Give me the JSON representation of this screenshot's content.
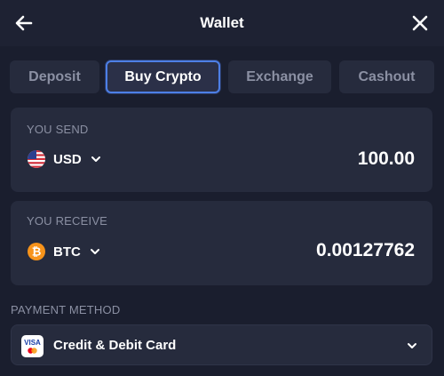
{
  "header": {
    "title": "Wallet",
    "back_icon": "arrow-left-icon",
    "close_icon": "close-icon"
  },
  "tabs": [
    {
      "label": "Deposit",
      "active": false
    },
    {
      "label": "Buy Crypto",
      "active": true
    },
    {
      "label": "Exchange",
      "active": false
    },
    {
      "label": "Cashout",
      "active": false
    }
  ],
  "send": {
    "label": "YOU SEND",
    "currency": "USD",
    "amount": "100.00",
    "icon": "us-flag-icon"
  },
  "receive": {
    "label": "YOU RECEIVE",
    "currency": "BTC",
    "amount": "0.00127762",
    "icon": "bitcoin-icon"
  },
  "payment": {
    "label": "PAYMENT METHOD",
    "selected": "Credit & Debit Card",
    "icon": "visa-mastercard-icon",
    "badge": "VISA"
  },
  "colors": {
    "background": "#1a1e2e",
    "card": "#262b3d",
    "accent": "#4d7fe6",
    "bitcoin": "#f7931a",
    "muted": "#8b90a3"
  }
}
